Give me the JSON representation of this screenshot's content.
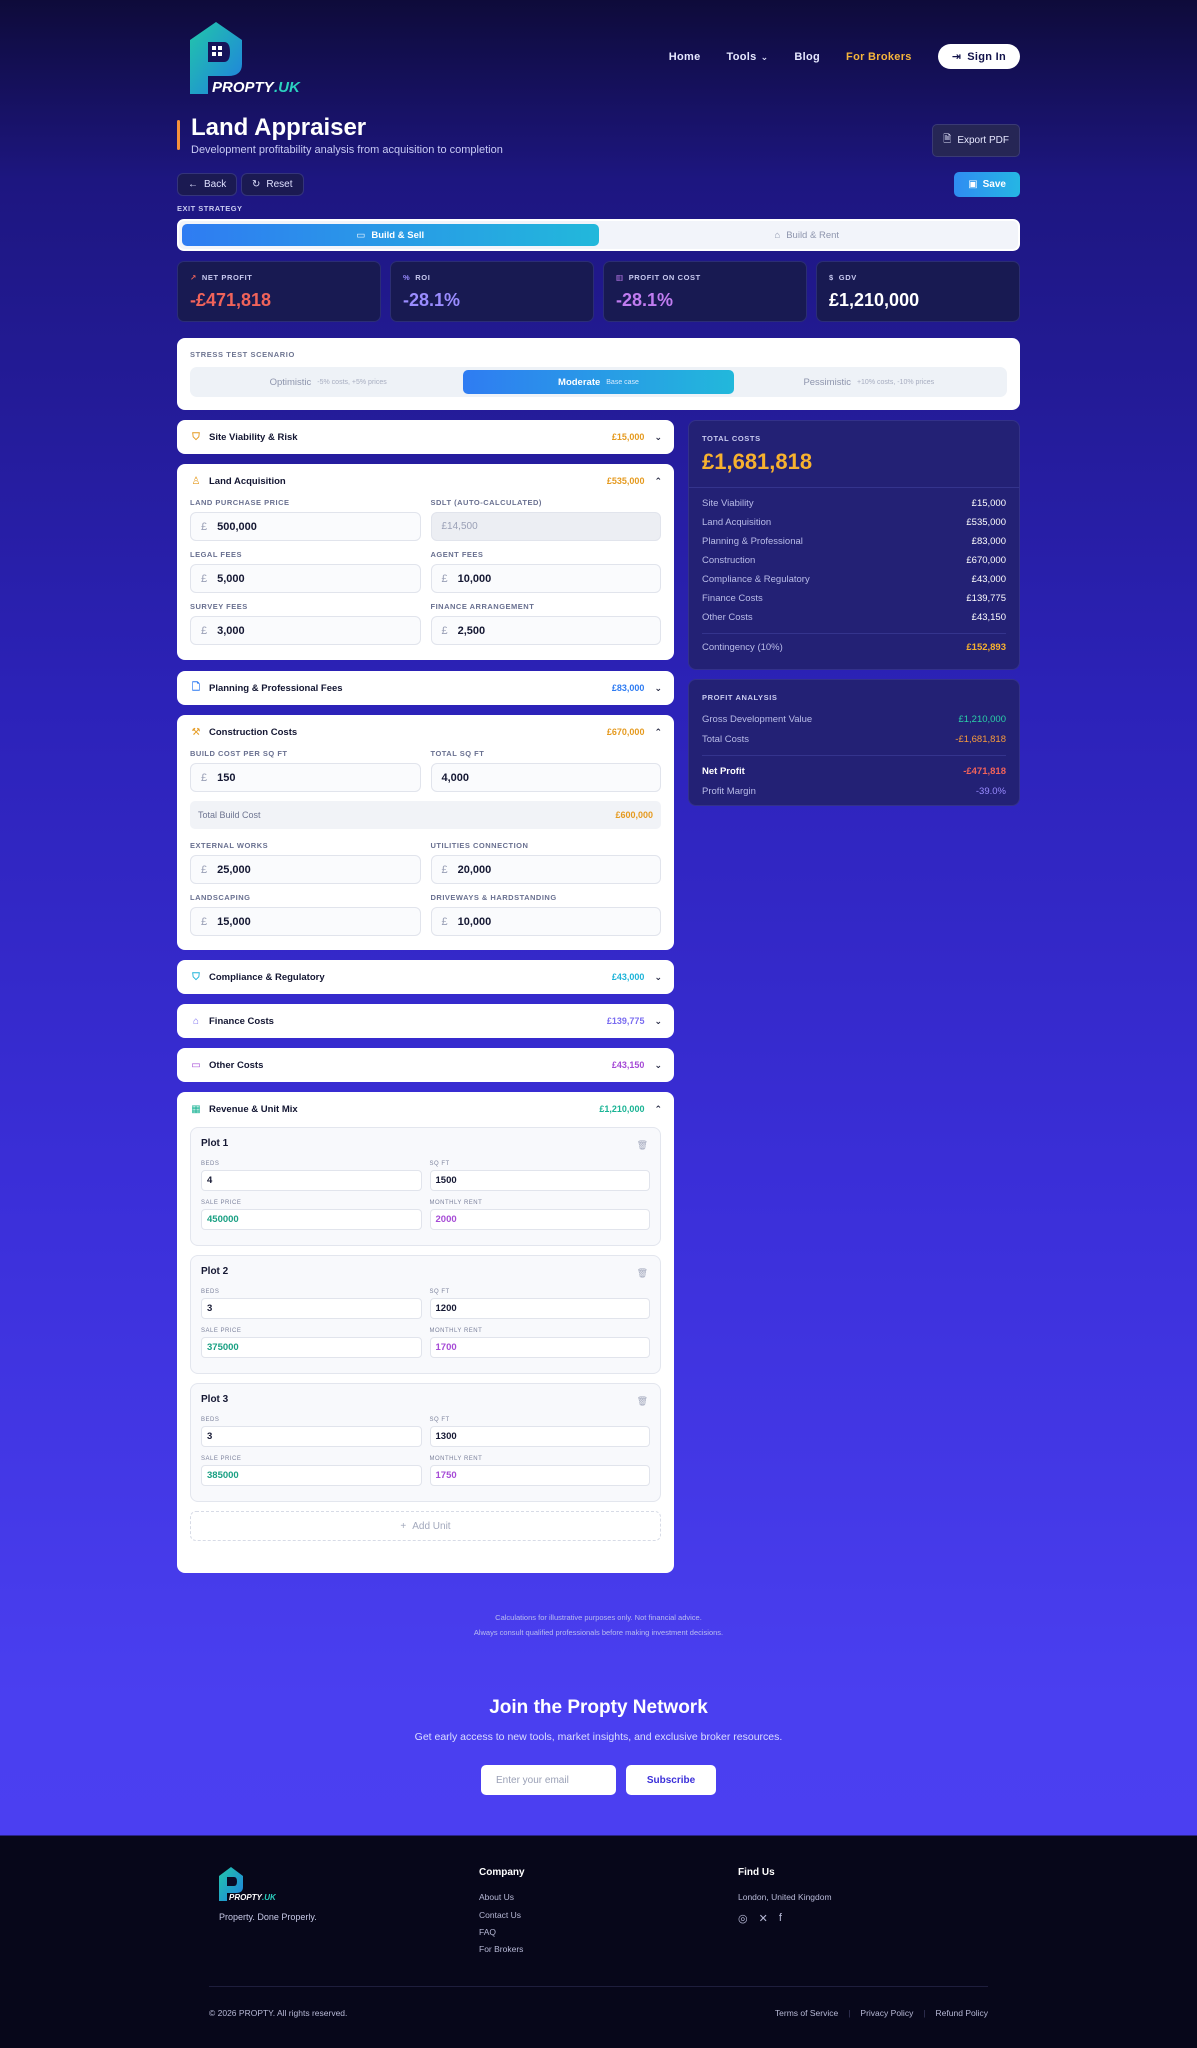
{
  "brand": {
    "name": "PROPTY",
    "suffix": ".UK"
  },
  "nav": {
    "home": "Home",
    "tools": "Tools",
    "blog": "Blog",
    "brokers": "For Brokers",
    "signin": "Sign In"
  },
  "page": {
    "title": "Land Appraiser",
    "subtitle": "Development profitability analysis from acquisition to completion",
    "export": "Export PDF",
    "back": "Back",
    "reset": "Reset",
    "save": "Save"
  },
  "exit": {
    "label": "EXIT STRATEGY",
    "build_sell": "Build & Sell",
    "build_rent": "Build & Rent"
  },
  "kpis": {
    "net_profit_label": "NET PROFIT",
    "net_profit": "-£471,818",
    "roi_label": "ROI",
    "roi": "-28.1%",
    "poc_label": "PROFIT ON COST",
    "poc": "-28.1%",
    "gdv_label": "GDV",
    "gdv": "£1,210,000"
  },
  "stress": {
    "label": "STRESS TEST SCENARIO",
    "optimistic": "Optimistic",
    "optimistic_note": "-5% costs, +5% prices",
    "moderate": "Moderate",
    "moderate_note": "Base case",
    "pessimistic": "Pessimistic",
    "pessimistic_note": "+10% costs, -10% prices"
  },
  "sections": {
    "site": {
      "title": "Site Viability & Risk",
      "amount": "£15,000"
    },
    "land": {
      "title": "Land Acquisition",
      "amount": "£535,000",
      "purchase_label": "LAND PURCHASE PRICE",
      "purchase": "500,000",
      "sdlt_label": "SDLT (AUTO-CALCULATED)",
      "sdlt": "£14,500",
      "legal_label": "LEGAL FEES",
      "legal": "5,000",
      "agent_label": "AGENT FEES",
      "agent": "10,000",
      "survey_label": "SURVEY FEES",
      "survey": "3,000",
      "finance_label": "FINANCE ARRANGEMENT",
      "finance": "2,500"
    },
    "planning": {
      "title": "Planning & Professional Fees",
      "amount": "£83,000"
    },
    "construction": {
      "title": "Construction Costs",
      "amount": "£670,000",
      "bcost_label": "BUILD COST PER SQ FT",
      "bcost": "150",
      "sqft_label": "TOTAL SQ FT",
      "sqft": "4,000",
      "tbc_label": "Total Build Cost",
      "tbc": "£600,000",
      "ext_label": "EXTERNAL WORKS",
      "ext": "25,000",
      "util_label": "UTILITIES CONNECTION",
      "util": "20,000",
      "land_label": "LANDSCAPING",
      "land": "15,000",
      "drive_label": "DRIVEWAYS & HARDSTANDING",
      "drive": "10,000"
    },
    "compliance": {
      "title": "Compliance & Regulatory",
      "amount": "£43,000"
    },
    "finance": {
      "title": "Finance Costs",
      "amount": "£139,775"
    },
    "other": {
      "title": "Other Costs",
      "amount": "£43,150"
    },
    "revenue": {
      "title": "Revenue & Unit Mix",
      "amount": "£1,210,000",
      "add": "Add Unit"
    }
  },
  "currency": "£",
  "plot_labels": {
    "beds": "BEDS",
    "sqft": "SQ FT",
    "sale": "SALE PRICE",
    "rent": "MONTHLY RENT"
  },
  "plots": [
    {
      "name": "Plot 1",
      "beds": "4",
      "sqft": "1500",
      "sale": "450000",
      "rent": "2000"
    },
    {
      "name": "Plot 2",
      "beds": "3",
      "sqft": "1200",
      "sale": "375000",
      "rent": "1700"
    },
    {
      "name": "Plot 3",
      "beds": "3",
      "sqft": "1300",
      "sale": "385000",
      "rent": "1750"
    }
  ],
  "totals": {
    "label": "TOTAL COSTS",
    "value": "£1,681,818",
    "rows": [
      {
        "k": "Site Viability",
        "v": "£15,000"
      },
      {
        "k": "Land Acquisition",
        "v": "£535,000"
      },
      {
        "k": "Planning & Professional",
        "v": "£83,000"
      },
      {
        "k": "Construction",
        "v": "£670,000"
      },
      {
        "k": "Compliance & Regulatory",
        "v": "£43,000"
      },
      {
        "k": "Finance Costs",
        "v": "£139,775"
      },
      {
        "k": "Other Costs",
        "v": "£43,150"
      }
    ],
    "contingency_label": "Contingency (10%)",
    "contingency": "£152,893"
  },
  "analysis": {
    "label": "PROFIT ANALYSIS",
    "gdv_label": "Gross Development Value",
    "gdv": "£1,210,000",
    "costs_label": "Total Costs",
    "costs": "-£1,681,818",
    "net_label": "Net Profit",
    "net": "-£471,818",
    "margin_label": "Profit Margin",
    "margin": "-39.0%"
  },
  "disclaimer": {
    "line1": "Calculations for illustrative purposes only. Not financial advice.",
    "line2": "Always consult qualified professionals before making investment decisions."
  },
  "join": {
    "title": "Join the Propty Network",
    "subtitle": "Get early access to new tools, market insights, and exclusive broker resources.",
    "placeholder": "Enter your email",
    "button": "Subscribe"
  },
  "footer": {
    "tagline": "Property. Done Properly.",
    "company": "Company",
    "links": [
      "About Us",
      "Contact Us",
      "FAQ",
      "For Brokers"
    ],
    "find": "Find Us",
    "location": "London, United Kingdom",
    "copyright": "© 2026 PROPTY. All rights reserved.",
    "terms": "Terms of Service",
    "privacy": "Privacy Policy",
    "refund": "Refund Policy"
  },
  "colors": {
    "orange": "#f5923b",
    "amber": "#e59a1f",
    "blue": "#2f7cf2",
    "teal": "#19b394",
    "purple": "#a64bd6",
    "red": "#f0635a",
    "violet": "#9a8cff"
  }
}
